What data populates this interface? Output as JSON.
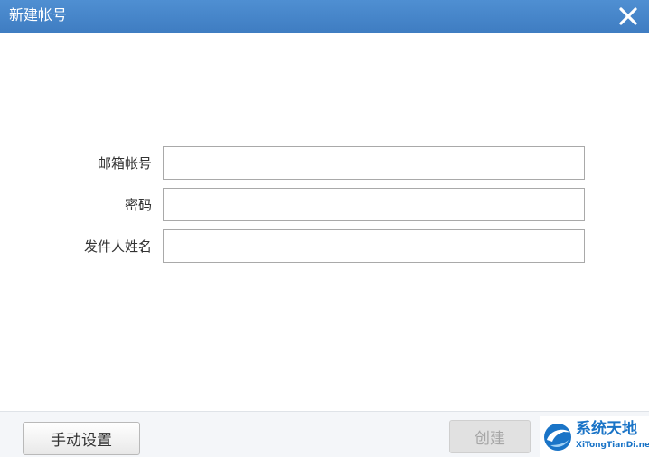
{
  "dialog": {
    "title": "新建帐号",
    "close_icon": "close-icon"
  },
  "form": {
    "fields": [
      {
        "label": "邮箱帐号",
        "colon": "：",
        "value": "",
        "placeholder": ""
      },
      {
        "label": "密码",
        "colon": "：",
        "value": "",
        "placeholder": ""
      },
      {
        "label": "发件人姓名",
        "colon": "：",
        "value": "",
        "placeholder": ""
      }
    ]
  },
  "footer": {
    "manual_settings_label": "手动设置",
    "create_label": "创建"
  },
  "watermark": {
    "logo_icon": "xitongtiandi-logo-icon",
    "name_cn": "系统天地",
    "name_en": "XiTongTianDi.net"
  },
  "colors": {
    "titlebar": "#4584c8",
    "watermark_blue": "#1a74c7",
    "disabled_button": "#e1e1e1"
  }
}
